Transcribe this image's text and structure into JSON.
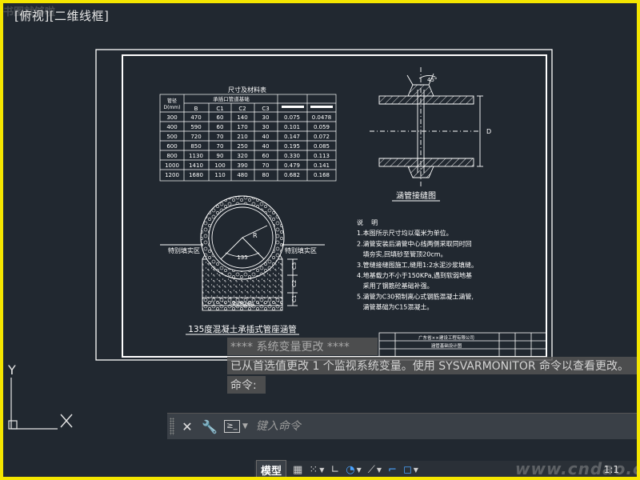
{
  "viewport": {
    "label": "[俯视][二维线框]",
    "watermark": "书图就够啦"
  },
  "drawing": {
    "table": {
      "title": "尺寸及材料表",
      "subheader": "承插口管道基础",
      "headers": [
        "管径 D(mm)",
        "B",
        "C1",
        "C2",
        "C3",
        "",
        ""
      ],
      "rows": [
        [
          "300",
          "470",
          "60",
          "140",
          "30",
          "0.075",
          "0.0478"
        ],
        [
          "400",
          "590",
          "60",
          "170",
          "30",
          "0.101",
          "0.059"
        ],
        [
          "500",
          "720",
          "70",
          "210",
          "40",
          "0.147",
          "0.072"
        ],
        [
          "600",
          "850",
          "70",
          "250",
          "40",
          "0.195",
          "0.085"
        ],
        [
          "800",
          "1130",
          "90",
          "320",
          "60",
          "0.330",
          "0.113"
        ],
        [
          "1000",
          "1410",
          "100",
          "390",
          "70",
          "0.479",
          "0.141"
        ],
        [
          "1200",
          "1680",
          "110",
          "480",
          "80",
          "0.682",
          "0.168"
        ]
      ]
    },
    "joint_title": "涵管接缝图",
    "joint_angle": "45°",
    "joint_dim": "D",
    "section_title": "135度混凝土承插式管座涵管",
    "left_label": "特别填实区",
    "right_label": "特别填实区",
    "angle_135": "135",
    "radius_label": "R",
    "dim_labels": [
      "C3",
      "C2",
      "C1"
    ],
    "gravel_label": "天然砂砾",
    "notes": [
      "说    明",
      "1.本图所示尺寸均以毫米为单位。",
      "2.涵管安装后涵管中心线两侧采取同时回",
      "   填夯实,回填砂至管顶20cm。",
      "3.管缝接缝图施工,缝用1:2水泥沙浆填缝。",
      "4.地基载力不小于150KPa,遇到软弱地基",
      "   采用了钢筋砼基础补强。",
      "5.涵管为C30预制离心式钢筋混凝土涵管,",
      "   涵管基础为C15混凝土。"
    ],
    "title_block": "广东省××建设工程有限公司",
    "title_block_2": "涵管基础设计图",
    "ucs_y": "Y",
    "ucs_x": "X"
  },
  "command": {
    "history": [
      "****  系统变量更改  ****",
      "已从首选值更改 1 个监视系统变量。使用 SYSVARMONITOR 命令以查看更改。",
      "命令:"
    ],
    "placeholder": "键入命令",
    "close_glyph": "✕",
    "settings_glyph": "🔧",
    "selector_glyph": "≥_"
  },
  "status": {
    "model_tab": "模型",
    "scale": "1:1",
    "icons": [
      "grid-icon",
      "snap-icon",
      "ortho-icon",
      "polar-icon",
      "isodraft-icon",
      "osnap-icon",
      "annotation-icon"
    ]
  },
  "watermark_br": "www.cndao.com",
  "colors": {
    "canvas_bg": "#212830",
    "frame": "#ffffff",
    "hatch": "#e8e8e8",
    "accent": "#4aa3ff"
  }
}
